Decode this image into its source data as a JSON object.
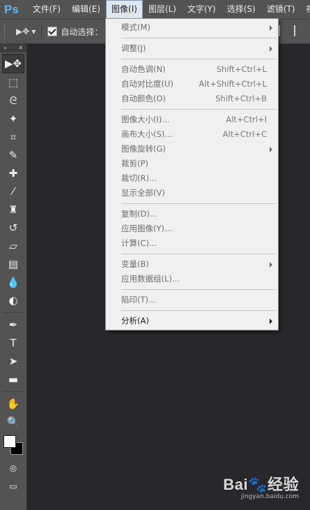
{
  "app": {
    "logo": "Ps"
  },
  "menubar": {
    "items": [
      {
        "label": "文件(F)"
      },
      {
        "label": "编辑(E)"
      },
      {
        "label": "图像(I)",
        "active": true
      },
      {
        "label": "图层(L)"
      },
      {
        "label": "文字(Y)"
      },
      {
        "label": "选择(S)"
      },
      {
        "label": "滤镜(T)"
      },
      {
        "label": "视"
      }
    ]
  },
  "options_bar": {
    "auto_select_label": "自动选择："
  },
  "image_menu": {
    "groups": [
      [
        {
          "label": "模式(M)",
          "submenu": true,
          "enabled": false
        }
      ],
      [
        {
          "label": "调整(J)",
          "submenu": true,
          "enabled": false
        }
      ],
      [
        {
          "label": "自动色调(N)",
          "shortcut": "Shift+Ctrl+L",
          "enabled": false
        },
        {
          "label": "自动对比度(U)",
          "shortcut": "Alt+Shift+Ctrl+L",
          "enabled": false
        },
        {
          "label": "自动颜色(O)",
          "shortcut": "Shift+Ctrl+B",
          "enabled": false
        }
      ],
      [
        {
          "label": "图像大小(I)...",
          "shortcut": "Alt+Ctrl+I",
          "enabled": false
        },
        {
          "label": "画布大小(S)...",
          "shortcut": "Alt+Ctrl+C",
          "enabled": false
        },
        {
          "label": "图像旋转(G)",
          "submenu": true,
          "enabled": false
        },
        {
          "label": "裁剪(P)",
          "enabled": false
        },
        {
          "label": "裁切(R)...",
          "enabled": false
        },
        {
          "label": "显示全部(V)",
          "enabled": false
        }
      ],
      [
        {
          "label": "复制(D)...",
          "enabled": false
        },
        {
          "label": "应用图像(Y)...",
          "enabled": false
        },
        {
          "label": "计算(C)...",
          "enabled": false
        }
      ],
      [
        {
          "label": "变量(B)",
          "submenu": true,
          "enabled": false
        },
        {
          "label": "应用数据组(L)...",
          "enabled": false
        }
      ],
      [
        {
          "label": "陷印(T)...",
          "enabled": false
        }
      ],
      [
        {
          "label": "分析(A)",
          "submenu": true,
          "enabled": true
        }
      ]
    ]
  },
  "tools": [
    {
      "name": "move-tool-icon",
      "glyph": "▶✥",
      "selected": true
    },
    {
      "name": "marquee-tool-icon",
      "glyph": "⬚"
    },
    {
      "name": "lasso-tool-icon",
      "glyph": "ᘓ"
    },
    {
      "name": "magic-wand-tool-icon",
      "glyph": "✦"
    },
    {
      "name": "crop-tool-icon",
      "glyph": "⌗"
    },
    {
      "name": "eyedropper-tool-icon",
      "glyph": "✎"
    },
    {
      "name": "healing-brush-tool-icon",
      "glyph": "✚"
    },
    {
      "name": "brush-tool-icon",
      "glyph": "⁄"
    },
    {
      "name": "clone-stamp-tool-icon",
      "glyph": "♜"
    },
    {
      "name": "history-brush-tool-icon",
      "glyph": "↺"
    },
    {
      "name": "eraser-tool-icon",
      "glyph": "▱"
    },
    {
      "name": "gradient-tool-icon",
      "glyph": "▤"
    },
    {
      "name": "blur-tool-icon",
      "glyph": "💧"
    },
    {
      "name": "dodge-tool-icon",
      "glyph": "◐"
    },
    {
      "name": "pen-tool-icon",
      "glyph": "✒"
    },
    {
      "name": "type-tool-icon",
      "glyph": "T"
    },
    {
      "name": "path-selection-tool-icon",
      "glyph": "➤"
    },
    {
      "name": "rectangle-tool-icon",
      "glyph": "▬"
    },
    {
      "name": "hand-tool-icon",
      "glyph": "✋"
    },
    {
      "name": "zoom-tool-icon",
      "glyph": "🔍"
    }
  ],
  "watermark": {
    "logo": "Bai🐾经验",
    "url": "jingyan.baidu.com"
  }
}
